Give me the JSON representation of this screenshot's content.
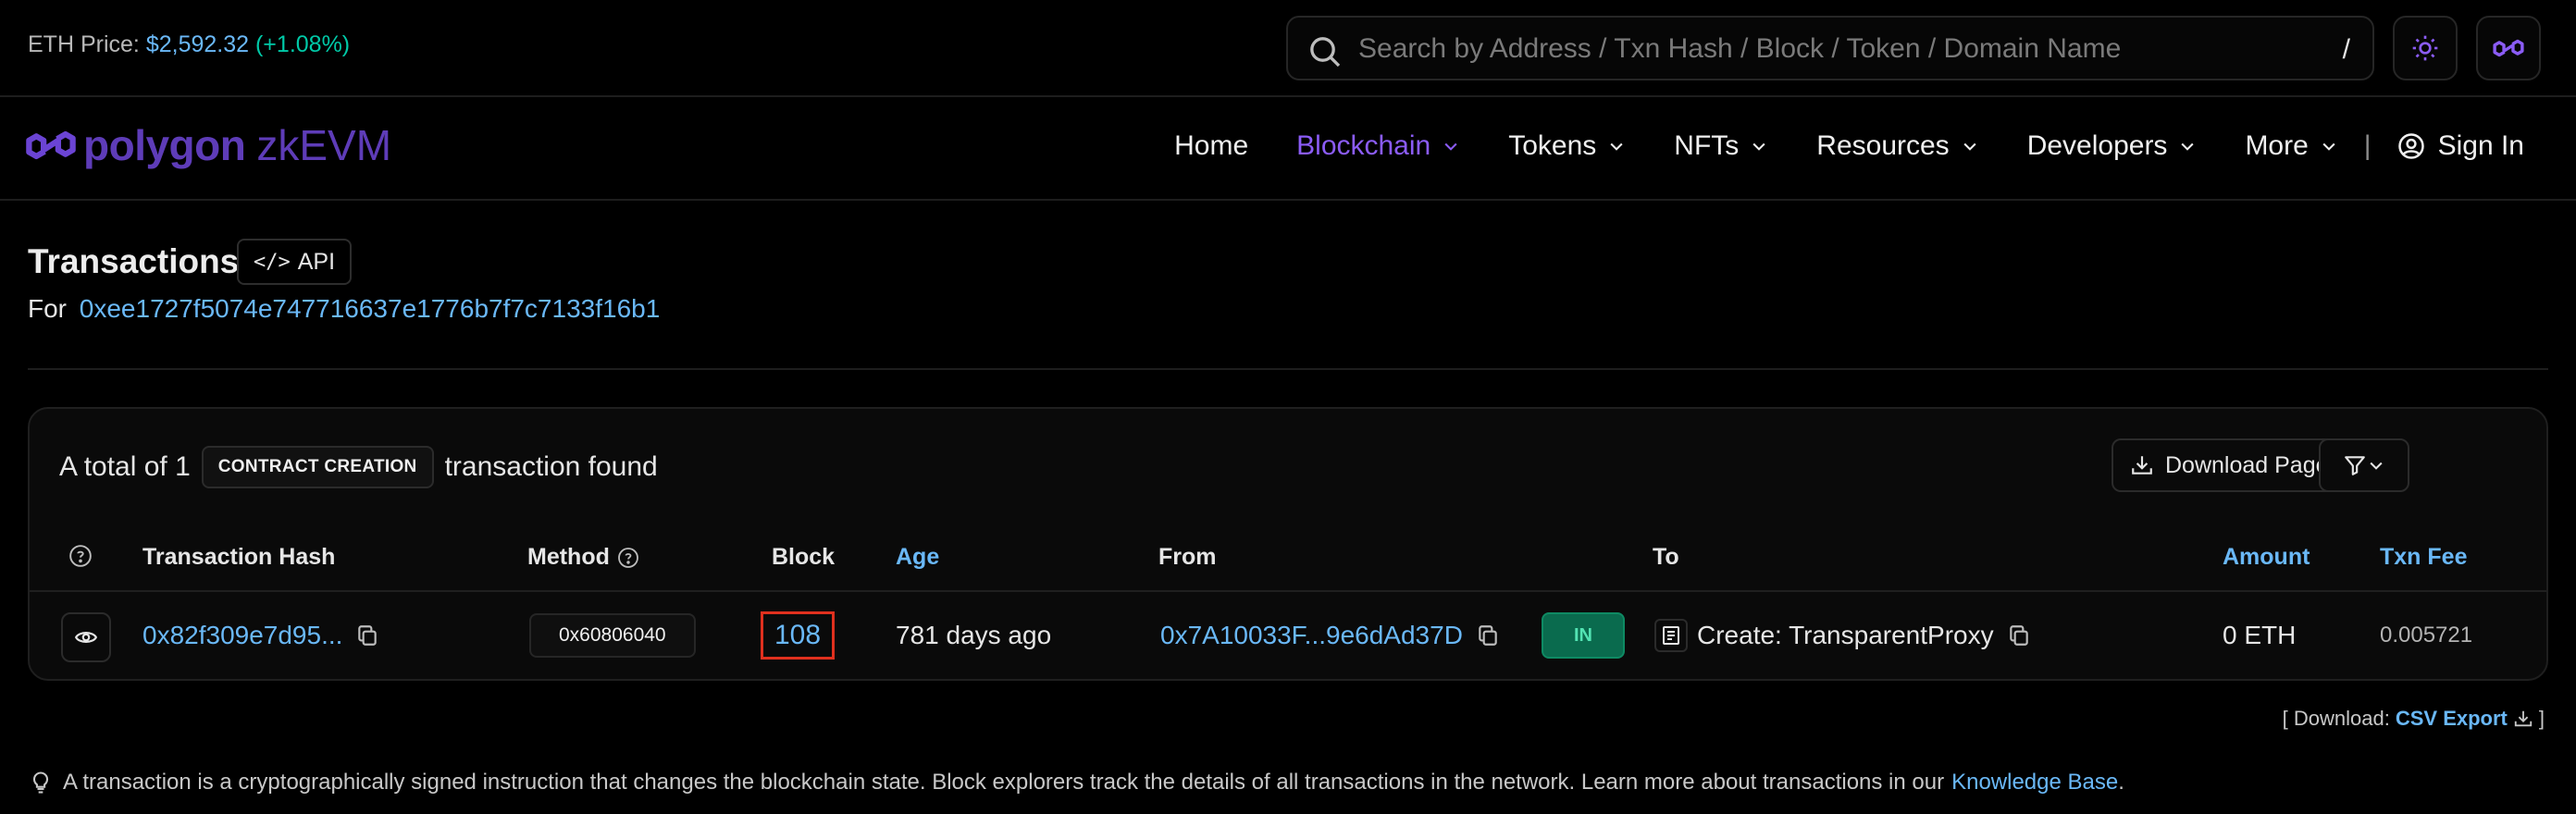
{
  "topbar": {
    "eth_label": "ETH Price:",
    "eth_price": "$2,592.32",
    "eth_change": "(+1.08%)",
    "search_placeholder": "Search by Address / Txn Hash / Block / Token / Domain Name",
    "search_shortcut": "/"
  },
  "brand": {
    "word1": "polygon",
    "word2": "zkEVM"
  },
  "nav": {
    "home": "Home",
    "blockchain": "Blockchain",
    "tokens": "Tokens",
    "nfts": "NFTs",
    "resources": "Resources",
    "developers": "Developers",
    "more": "More",
    "separator": "|",
    "sign_in": "Sign In"
  },
  "header": {
    "title": "Transactions",
    "api_label": "API",
    "api_code": "</>",
    "for_label": "For",
    "address": "0xee1727f5074e747716637e1776b7f7c7133f16b1"
  },
  "summary": {
    "prefix": "A total of 1",
    "badge": "CONTRACT CREATION",
    "suffix": "transaction found",
    "download_label": "Download Page Data"
  },
  "table": {
    "columns": {
      "hash": "Transaction Hash",
      "method": "Method",
      "block": "Block",
      "age": "Age",
      "from": "From",
      "to": "To",
      "amount": "Amount",
      "fee": "Txn Fee"
    },
    "rows": [
      {
        "hash": "0x82f309e7d95...",
        "method": "0x60806040",
        "block": "108",
        "age": "781 days ago",
        "from": "0x7A10033F...9e6dAd37D",
        "direction": "IN",
        "to": "Create: TransparentProxy",
        "amount": "0 ETH",
        "fee": "0.005721"
      }
    ]
  },
  "csv": {
    "prefix": "[ Download:",
    "link": "CSV Export",
    "suffix": "]"
  },
  "footnote": {
    "text": "A transaction is a cryptographically signed instruction that changes the blockchain state. Block explorers track the details of all transactions in the network. Learn more about transactions in our",
    "link": "Knowledge Base",
    "end": "."
  },
  "colors": {
    "accent": "#8b5cf6",
    "link": "#6ab8f7",
    "positive": "#00c9a7",
    "highlight": "#e0301e"
  }
}
